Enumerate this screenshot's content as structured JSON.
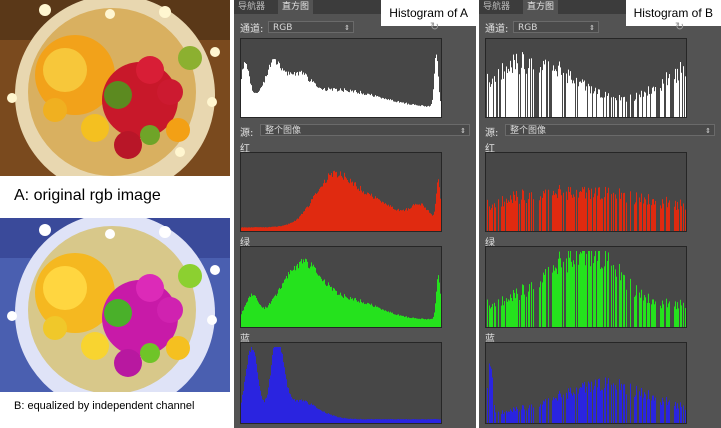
{
  "captions": {
    "a": "A: original rgb image",
    "b": "B: equalized by independent channel"
  },
  "panels": {
    "tab_navigator": "导航器",
    "tab_histogram": "直方图",
    "channel_label": "通道:",
    "channel_value": "RGB",
    "source_label": "源:",
    "source_value": "整个图像",
    "red_label": "红",
    "green_label": "绿",
    "blue_label": "蓝",
    "title_a": "Histogram of A",
    "title_b": "Histogram of B"
  },
  "colors": {
    "panel_bg": "#535353",
    "graph_bg": "#474747",
    "luminosity": "#ffffff",
    "red": "#e02a10",
    "green": "#25e21d",
    "blue": "#2a24e0"
  },
  "icons": {
    "dropdown": "double-arrow-icon",
    "refresh": "refresh-icon"
  }
}
